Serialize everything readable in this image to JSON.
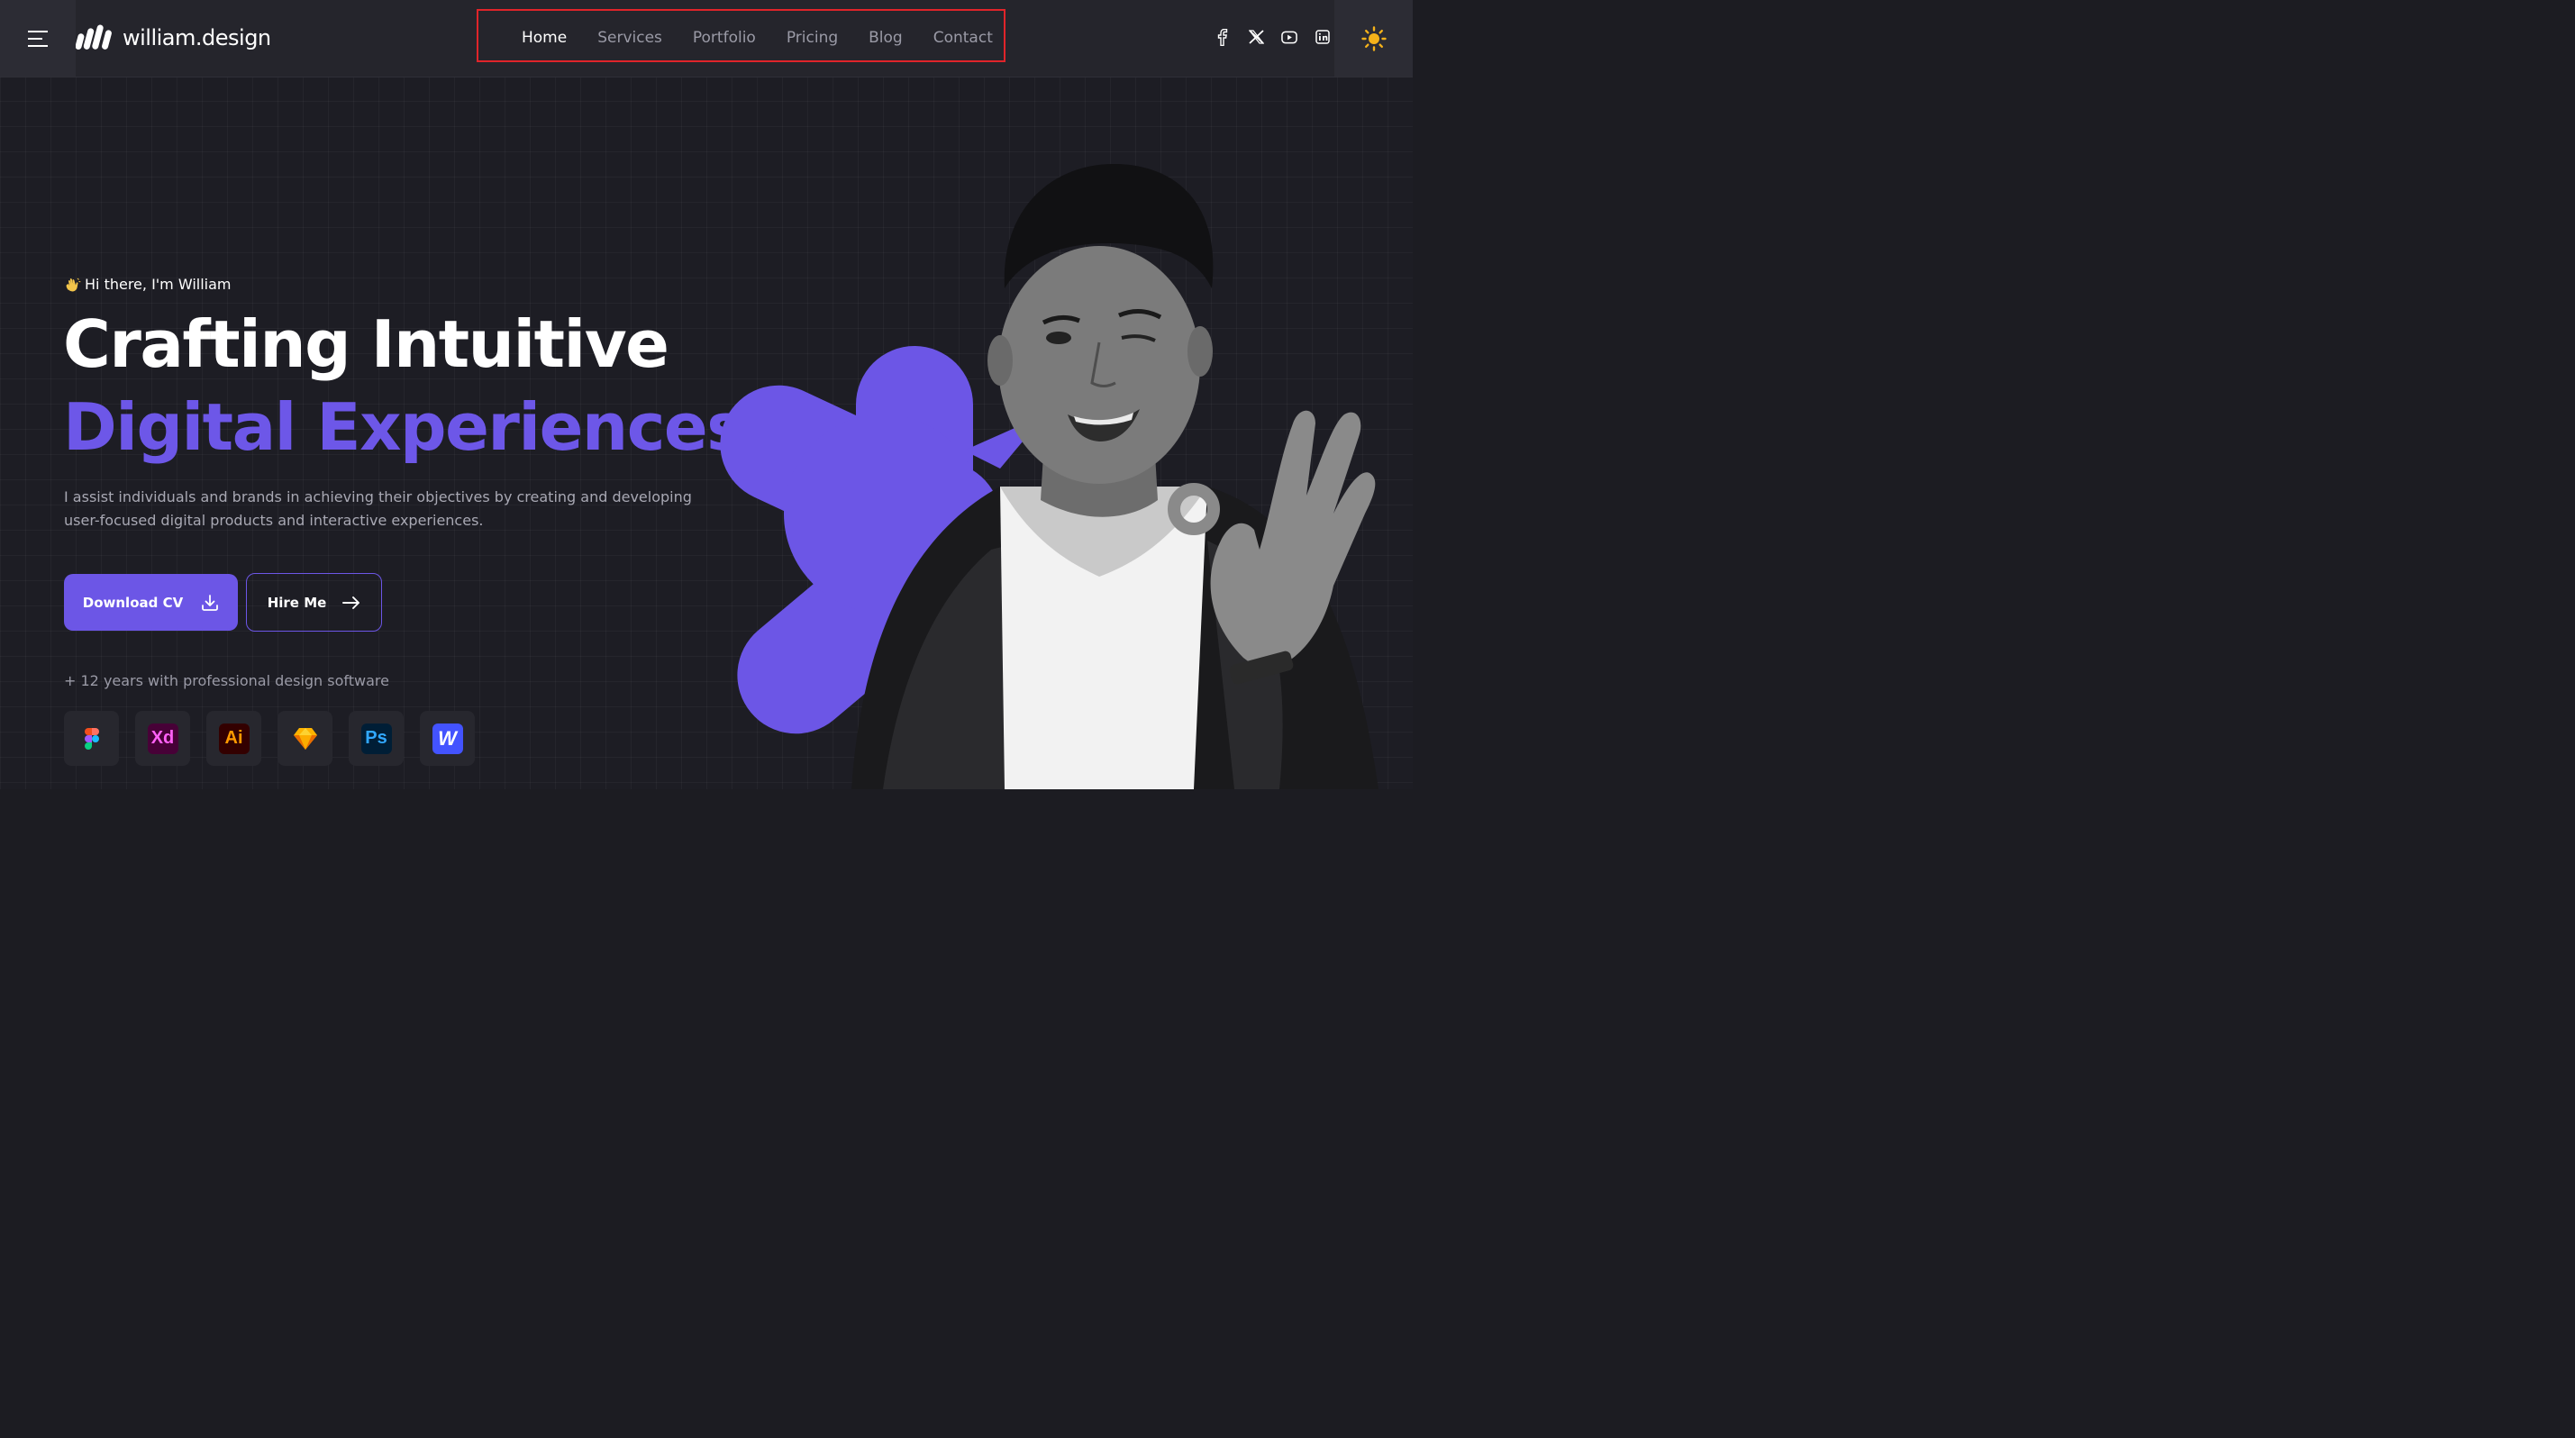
{
  "header": {
    "logo_text": "william.design",
    "nav": [
      {
        "label": "Home",
        "active": true
      },
      {
        "label": "Services",
        "active": false
      },
      {
        "label": "Portfolio",
        "active": false
      },
      {
        "label": "Pricing",
        "active": false
      },
      {
        "label": "Blog",
        "active": false
      },
      {
        "label": "Contact",
        "active": false
      }
    ],
    "socials": [
      "facebook-icon",
      "x-twitter-icon",
      "youtube-icon",
      "linkedin-icon"
    ],
    "theme_icon": "sun-icon",
    "menu_icon": "hamburger-menu-icon"
  },
  "hero": {
    "greeting_icon": "waving-hand-icon",
    "greeting": "Hi there, I'm William",
    "headline_line1": "Crafting Intuitive",
    "headline_line2": "Digital Experiences",
    "description_line1": "I assist individuals and brands in achieving their objectives by creating and developing",
    "description_line2": "user-focused digital products and interactive experiences.",
    "primary_button": "Download CV",
    "secondary_button": "Hire Me",
    "experience_text": "+ 12 years with professional design software",
    "tools": [
      {
        "name": "figma-icon",
        "label": ""
      },
      {
        "name": "adobe-xd-icon",
        "label": "Xd"
      },
      {
        "name": "adobe-illustrator-icon",
        "label": "Ai"
      },
      {
        "name": "sketch-icon",
        "label": ""
      },
      {
        "name": "adobe-photoshop-icon",
        "label": "Ps"
      },
      {
        "name": "webflow-icon",
        "label": "W"
      }
    ]
  },
  "colors": {
    "accent": "#6c56e6",
    "background": "#1d1d24",
    "header": "#25252c",
    "highlight_frame": "#e0242a",
    "sun": "#f5b21a"
  }
}
